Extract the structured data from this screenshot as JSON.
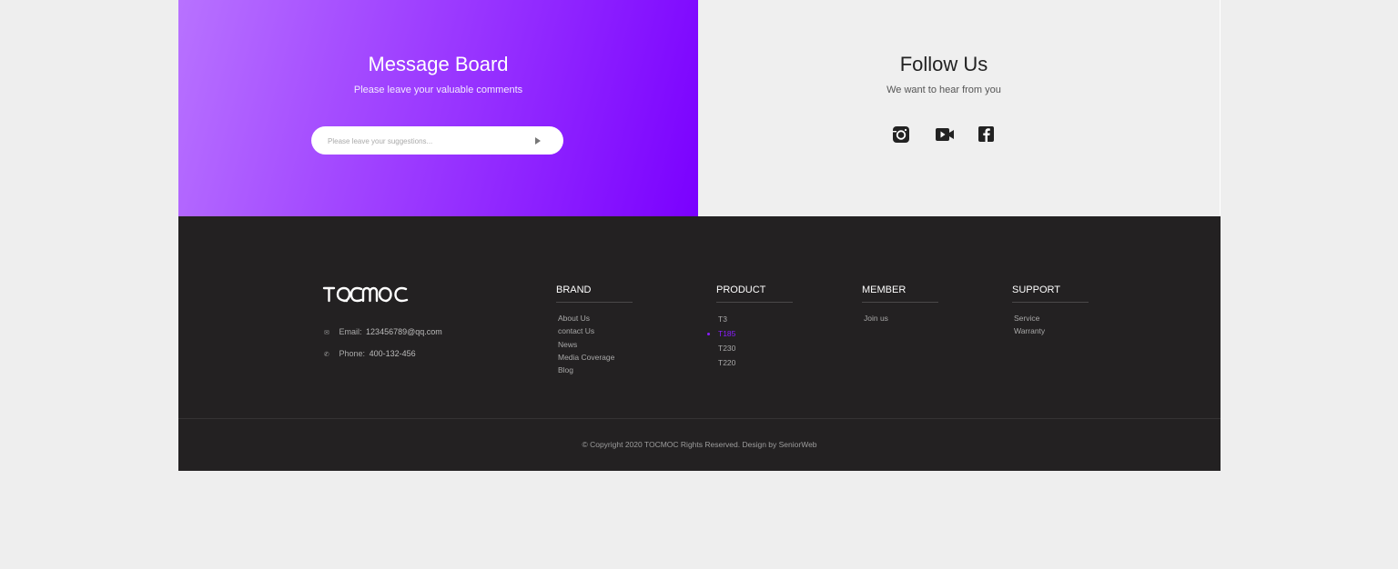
{
  "message_board": {
    "title": "Message Board",
    "subtitle": "Please leave your valuable comments",
    "input_placeholder": "Please leave your suggestions...",
    "send_icon": "play-triangle-icon"
  },
  "follow": {
    "title": "Follow Us",
    "subtitle": "We want to hear from you",
    "icons": [
      "instagram-icon",
      "video-camera-icon",
      "facebook-icon"
    ]
  },
  "footer": {
    "logo_text": "TOCMOC",
    "email_label": "Email:",
    "email_value": "123456789@qq.com",
    "phone_label": "Phone:",
    "phone_value": "400-132-456",
    "columns": [
      {
        "title": "BRAND",
        "links": [
          "About Us",
          "contact Us",
          "News",
          "Media Coverage",
          "Blog"
        ]
      },
      {
        "title": "PRODUCT",
        "links": [
          "T3",
          "T185",
          "T230",
          "T220"
        ],
        "active": "T185"
      },
      {
        "title": "MEMBER",
        "links": [
          "Join us"
        ]
      },
      {
        "title": "SUPPORT",
        "links": [
          "Service",
          "Warranty"
        ]
      }
    ],
    "copyright": "© Copyright 2020  TOCMOC  Rights Reserved. Design by SeniorWeb"
  },
  "colors": {
    "accent": "#8a1eff",
    "gradient_start": "#b872ff",
    "gradient_end": "#7a00ff",
    "footer_bg": "#232122",
    "page_bg": "#eeeeee"
  }
}
